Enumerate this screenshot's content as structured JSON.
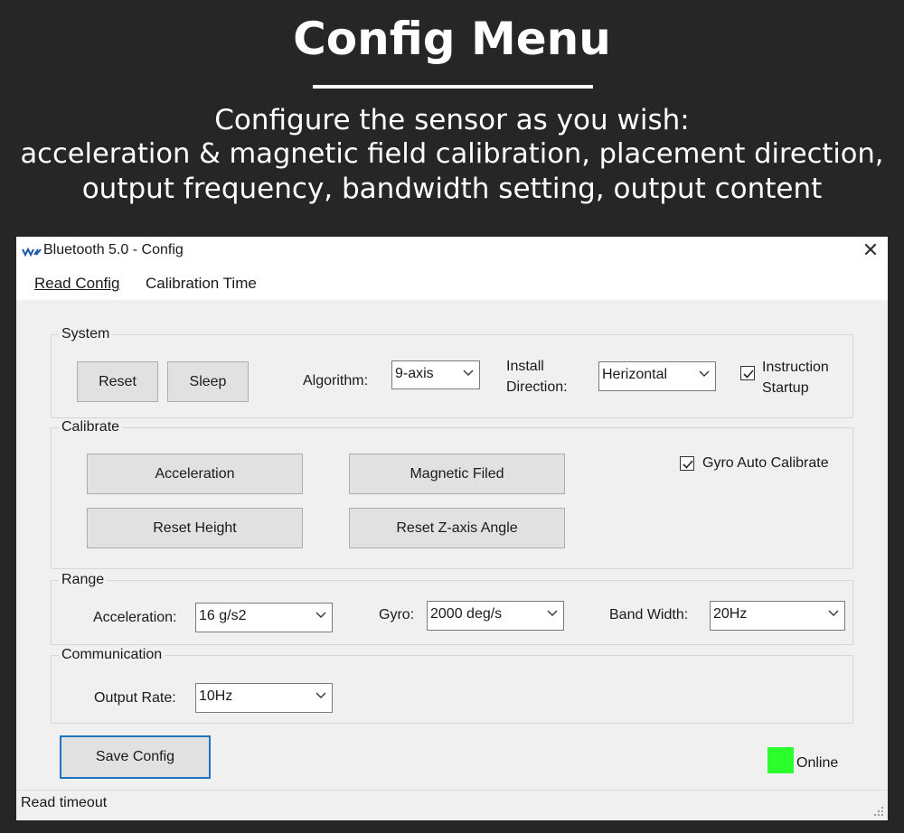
{
  "banner": {
    "title": "Config Menu",
    "line1": "Configure the sensor as you wish:",
    "line2": "acceleration & magnetic field calibration, placement direction,",
    "line3": "output frequency, bandwidth setting, output content"
  },
  "window": {
    "title": "Bluetooth 5.0 - Config",
    "close_glyph": "✕",
    "icon": "wit-logo-icon"
  },
  "menu": {
    "read_config": "Read Config",
    "calibration_time": "Calibration Time"
  },
  "system": {
    "label": "System",
    "reset": "Reset",
    "sleep": "Sleep",
    "algorithm_label": "Algorithm:",
    "algorithm_value": "9-axis",
    "install_label_1": "Install",
    "install_label_2": "Direction:",
    "install_value": "Herizontal",
    "instruction_label_1": "Instruction",
    "instruction_label_2": "Startup",
    "instruction_checked": true
  },
  "calibrate": {
    "label": "Calibrate",
    "acceleration": "Acceleration",
    "magnetic": "Magnetic Filed",
    "reset_height": "Reset Height",
    "reset_z": "Reset Z-axis Angle",
    "gyro_auto": "Gyro Auto Calibrate",
    "gyro_checked": true
  },
  "range": {
    "label": "Range",
    "accel_label": "Acceleration:",
    "accel_value": "16 g/s2",
    "gyro_label": "Gyro:",
    "gyro_value": "2000 deg/s",
    "bw_label": "Band Width:",
    "bw_value": "20Hz"
  },
  "communication": {
    "label": "Communication",
    "rate_label": "Output Rate:",
    "rate_value": "10Hz"
  },
  "footer": {
    "save": "Save Config",
    "online": "Online",
    "online_color": "#2cff2c",
    "status": "Read timeout"
  }
}
